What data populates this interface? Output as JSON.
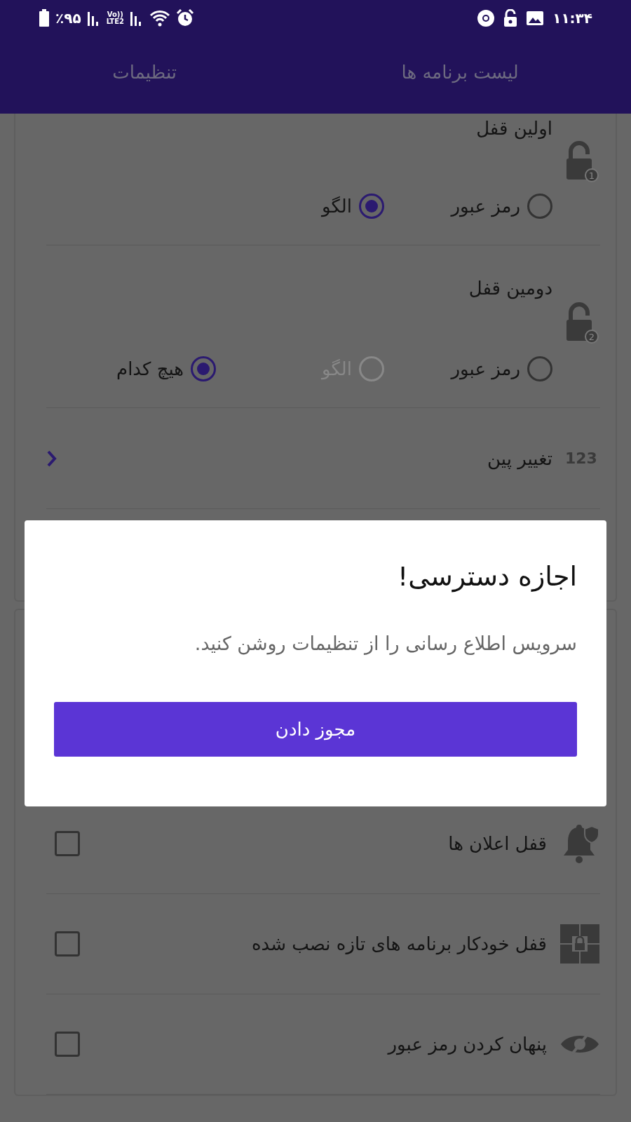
{
  "status_bar": {
    "battery": "٪۹۵",
    "network_labels": [
      "Vo))",
      "LTE2"
    ],
    "time": "۱۱:۳۴"
  },
  "tabs": [
    {
      "label": "لیست برنامه ها"
    },
    {
      "label": "تنظیمات"
    }
  ],
  "lock_settings": [
    {
      "title": "اولین قفل",
      "badge": "1",
      "options": [
        {
          "label": "رمز عبور",
          "selected": false,
          "disabled": false
        },
        {
          "label": "الگو",
          "selected": true,
          "disabled": false
        }
      ]
    },
    {
      "title": "دومین قفل",
      "badge": "2",
      "options": [
        {
          "label": "رمز عبور",
          "selected": false,
          "disabled": false
        },
        {
          "label": "الگو",
          "selected": false,
          "disabled": true
        },
        {
          "label": "هیچ کدام",
          "selected": true,
          "disabled": false
        }
      ]
    }
  ],
  "change_pin": {
    "icon_text": "123",
    "label": "تغییر پین"
  },
  "options": [
    {
      "label": "قفل اعلان ها",
      "checked": false
    },
    {
      "label": "قفل خودکار برنامه های تازه نصب شده",
      "checked": false
    },
    {
      "label": "پنهان کردن رمز عبور",
      "checked": false
    }
  ],
  "dialog": {
    "title": "اجازه دسترسی!",
    "message": "سرویس اطلاع رسانی را از تنظیمات روشن کنید.",
    "button": "مجوز دادن"
  }
}
